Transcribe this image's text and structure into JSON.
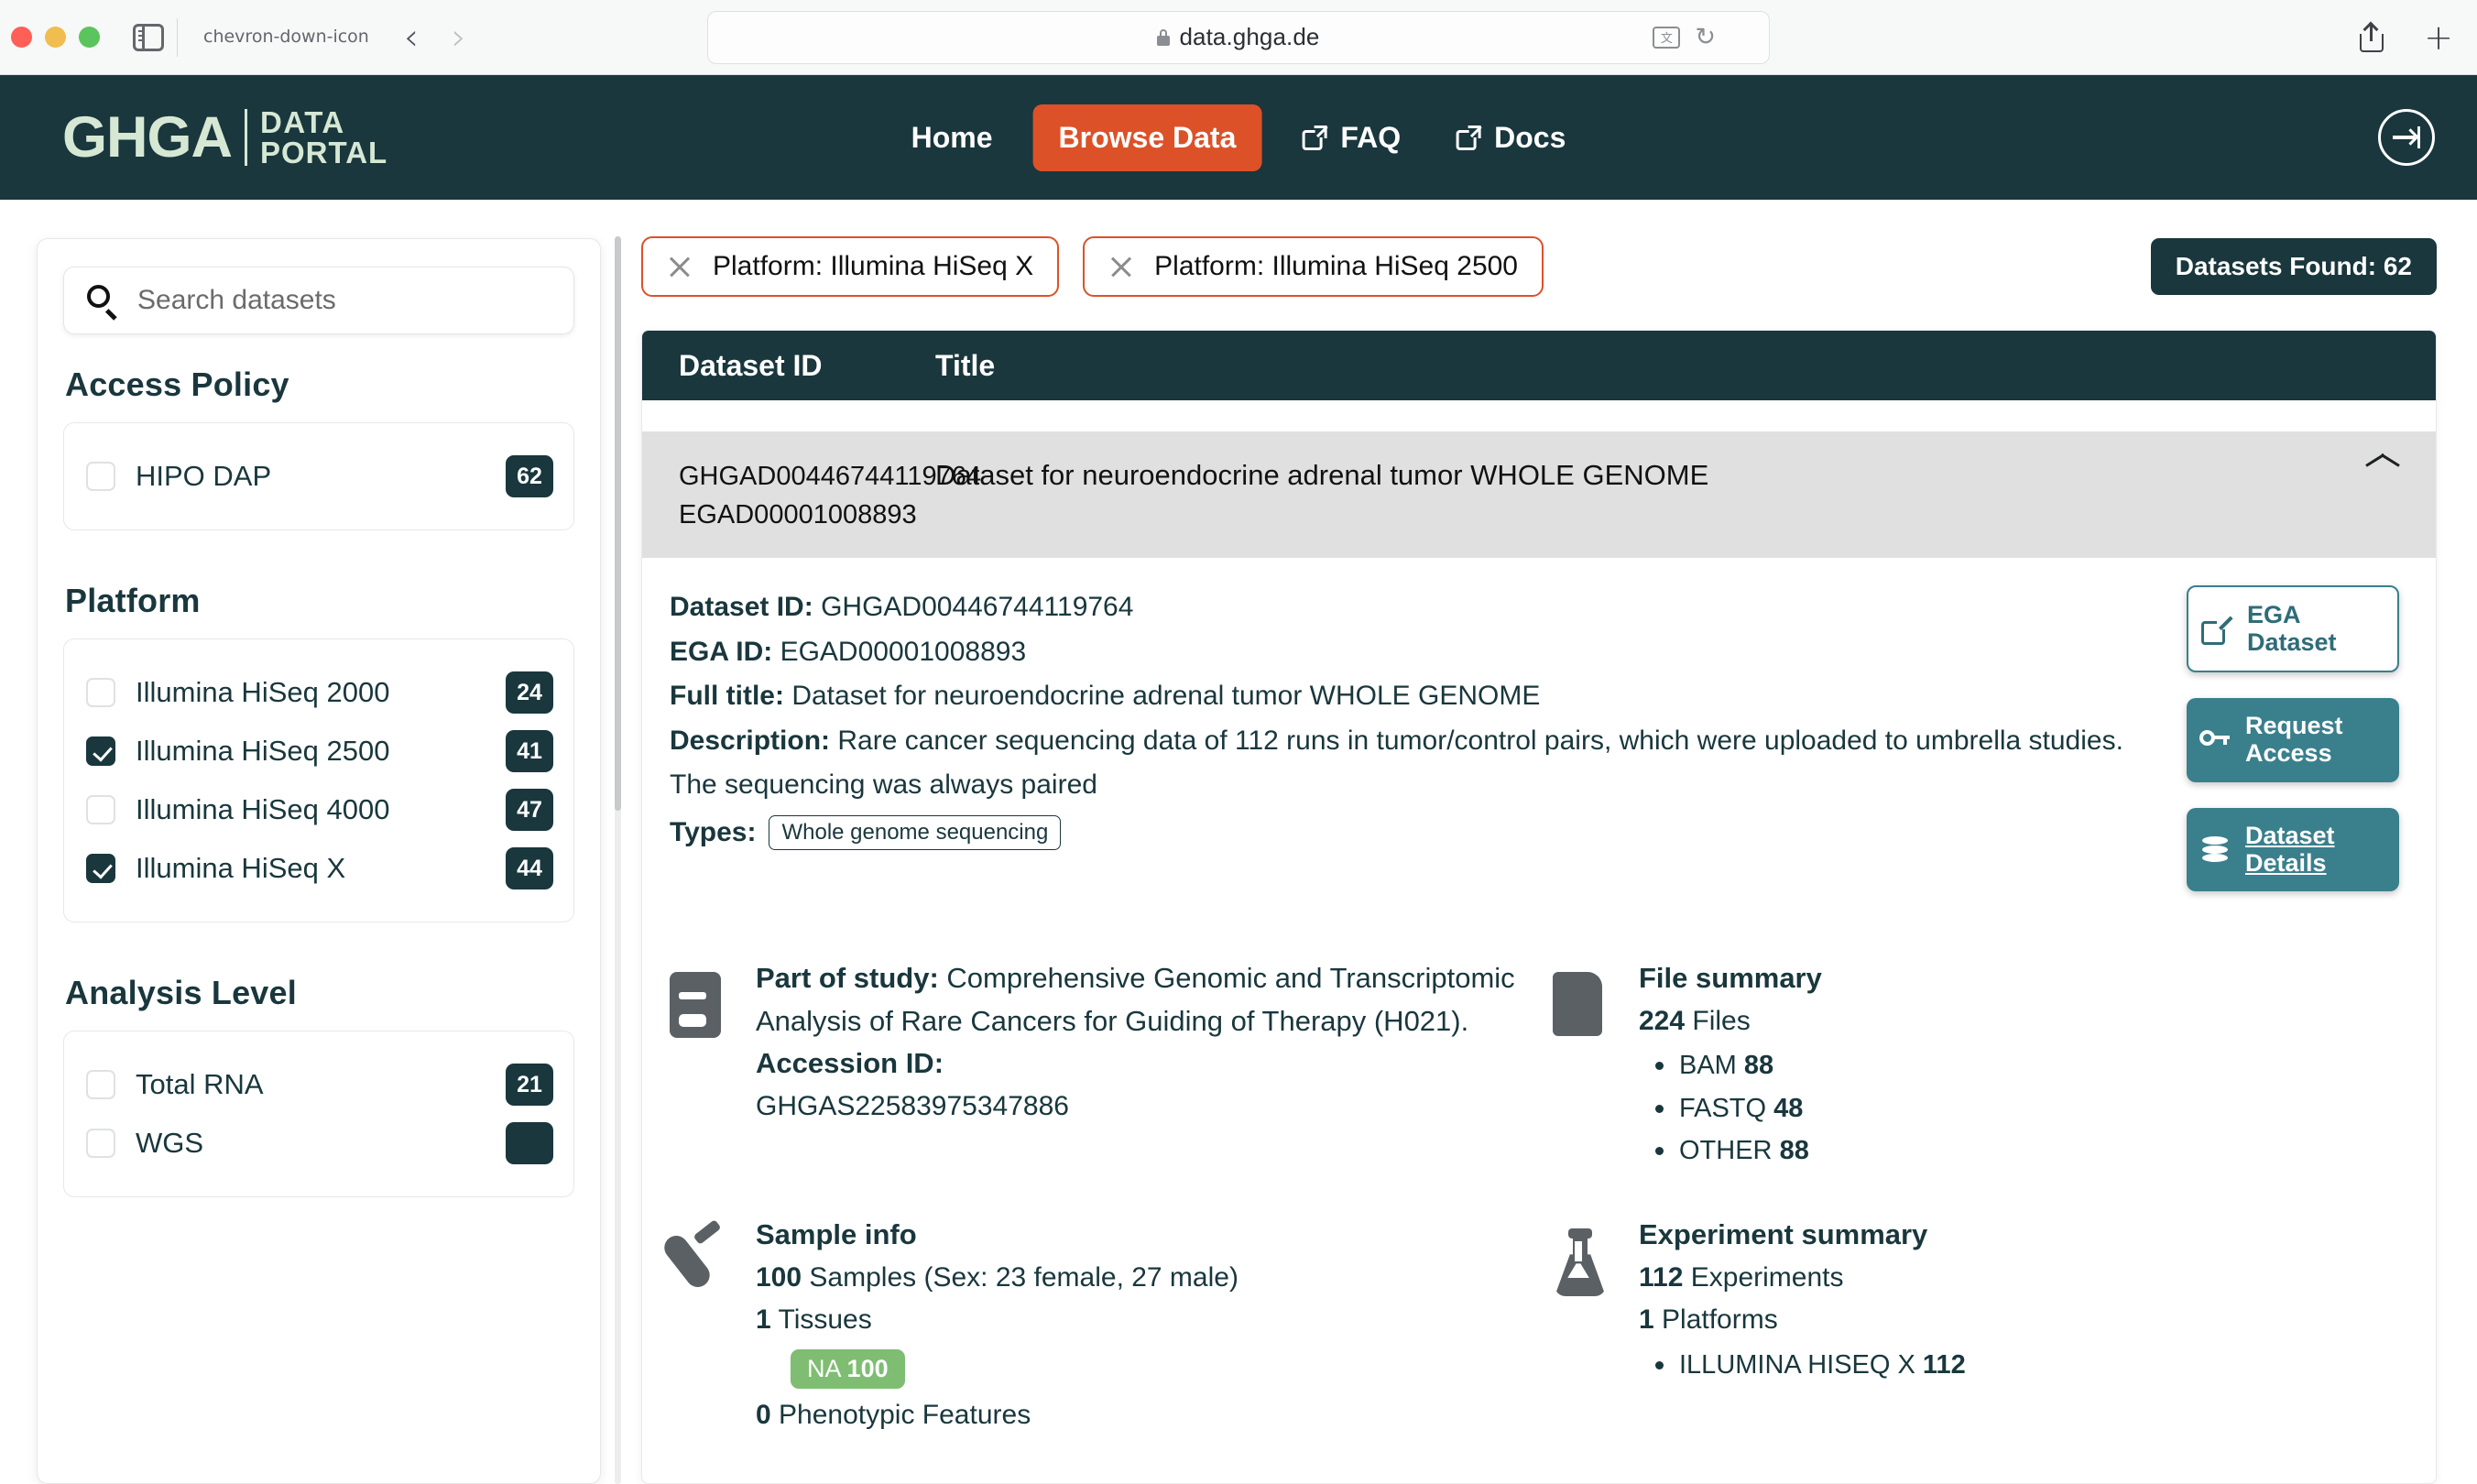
{
  "browser": {
    "url": "data.ghga.de",
    "icons": {
      "sidebar_toggle": "sidebar-toggle-icon",
      "tab_overview": "chevron-down-icon",
      "back": "‹",
      "forward": "›",
      "lock": "lock-icon",
      "translate": "文",
      "reload": "↻",
      "share": "share-icon",
      "new_tab": "+"
    }
  },
  "header": {
    "logo_mark": "GHGA",
    "logo_line1": "DATA",
    "logo_line2": "PORTAL",
    "nav": [
      {
        "label": "Home",
        "active": false,
        "external": false
      },
      {
        "label": "Browse Data",
        "active": true,
        "external": false
      },
      {
        "label": "FAQ",
        "active": false,
        "external": true
      },
      {
        "label": "Docs",
        "active": false,
        "external": true
      }
    ],
    "login_icon": "login-arrow-icon",
    "bg_color": "#19373d",
    "accent_color": "#dd5128"
  },
  "sidebar": {
    "search": {
      "placeholder": "Search datasets"
    },
    "facets": [
      {
        "title": "Access Policy",
        "options": [
          {
            "label": "HIPO DAP",
            "count": "62",
            "checked": false
          }
        ]
      },
      {
        "title": "Platform",
        "options": [
          {
            "label": "Illumina HiSeq 2000",
            "count": "24",
            "checked": false
          },
          {
            "label": "Illumina HiSeq 2500",
            "count": "41",
            "checked": true
          },
          {
            "label": "Illumina HiSeq 4000",
            "count": "47",
            "checked": false
          },
          {
            "label": "Illumina HiSeq X",
            "count": "44",
            "checked": true
          }
        ]
      },
      {
        "title": "Analysis Level",
        "options": [
          {
            "label": "Total RNA",
            "count": "21",
            "checked": false
          },
          {
            "label": "WGS",
            "count": "",
            "checked": false
          }
        ]
      }
    ]
  },
  "results": {
    "chips": [
      {
        "label": "Platform: Illumina HiSeq X"
      },
      {
        "label": "Platform: Illumina HiSeq 2500"
      }
    ],
    "found_badge": "Datasets Found: 62",
    "columns": {
      "id": "Dataset ID",
      "title": "Title"
    },
    "row": {
      "ghga_id": "GHGAD00446744119764",
      "ega_id": "EGAD00001008893",
      "title": "Dataset for neuroendocrine adrenal tumor WHOLE GENOME",
      "expanded": true
    },
    "detail": {
      "dataset_id_label": "Dataset ID:",
      "dataset_id_value": "GHGAD00446744119764",
      "ega_id_label": "EGA ID:",
      "ega_id_value": "EGAD00001008893",
      "full_title_label": "Full title:",
      "full_title_value": "Dataset for neuroendocrine adrenal tumor WHOLE GENOME",
      "description_label": "Description:",
      "description_value": "Rare cancer sequencing data of 112 runs in tumor/control pairs, which were uploaded to umbrella studies. The sequencing was always paired",
      "types_label": "Types:",
      "types_value": "Whole genome sequencing"
    },
    "actions": [
      {
        "label_line1": "EGA",
        "label_line2": "Dataset",
        "style": "outline",
        "icon": "external-link-icon"
      },
      {
        "label_line1": "Request",
        "label_line2": "Access",
        "style": "filled",
        "icon": "key-icon"
      },
      {
        "label_line1": "Dataset",
        "label_line2": "Details",
        "style": "filled-underline",
        "icon": "database-icon"
      }
    ],
    "summaries": {
      "study": {
        "icon": "book-icon",
        "label": "Part of study:",
        "value": "Comprehensive Genomic and Transcriptomic Analysis of Rare Cancers for Guiding of Therapy (H021).",
        "accession_label": "Accession ID:",
        "accession_value": "GHGAS22583975347886"
      },
      "files": {
        "icon": "document-icon",
        "title": "File summary",
        "total_count": "224",
        "total_label": "Files",
        "items": [
          {
            "name": "BAM",
            "count": "88"
          },
          {
            "name": "FASTQ",
            "count": "48"
          },
          {
            "name": "OTHER",
            "count": "88"
          }
        ]
      },
      "samples": {
        "icon": "test-tube-icon",
        "title": "Sample info",
        "samples_count": "100",
        "samples_label": "Samples (Sex:  23 female, 27 male)",
        "tissues_count": "1",
        "tissues_label": "Tissues",
        "tissue_pill_name": "NA",
        "tissue_pill_count": "100",
        "phenotypic_count": "0",
        "phenotypic_label": "Phenotypic Features"
      },
      "experiments": {
        "icon": "flask-icon",
        "title": "Experiment summary",
        "experiments_count": "112",
        "experiments_label": "Experiments",
        "platforms_count": "1",
        "platforms_label": "Platforms",
        "items": [
          {
            "name": "ILLUMINA HISEQ X",
            "count": "112"
          }
        ]
      }
    }
  }
}
